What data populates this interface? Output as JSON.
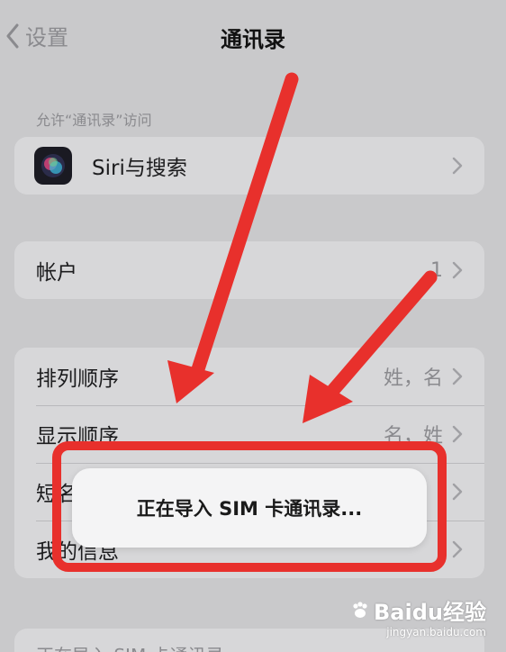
{
  "nav": {
    "back_label": "设置",
    "title": "通讯录"
  },
  "section_header": "允许“通讯录”访问",
  "siri_row": {
    "label": "Siri与搜索"
  },
  "accounts_row": {
    "label": "帐户",
    "value": "1"
  },
  "sort_row": {
    "label": "排列顺序",
    "value": "姓，名"
  },
  "display_row": {
    "label": "显示顺序",
    "value": "名，姓"
  },
  "short_name_row": {
    "label": "短名称"
  },
  "my_info_row": {
    "label": "我的信息"
  },
  "toast": {
    "text": "正在导入 SIM 卡通讯录..."
  },
  "bottom_row": {
    "label": "正在导入 SIM 卡通讯录"
  },
  "watermark": {
    "brand": "Baidu经验",
    "url": "jingyan.baidu.com"
  },
  "colors": {
    "annotation_red": "#e8302c",
    "background": "#c9c9cb",
    "cell": "#d7d7d9",
    "secondary_text": "#8a8a8e"
  },
  "icons": [
    "back-chevron-icon",
    "siri-icon",
    "chevron-right-icon",
    "paw-icon"
  ]
}
